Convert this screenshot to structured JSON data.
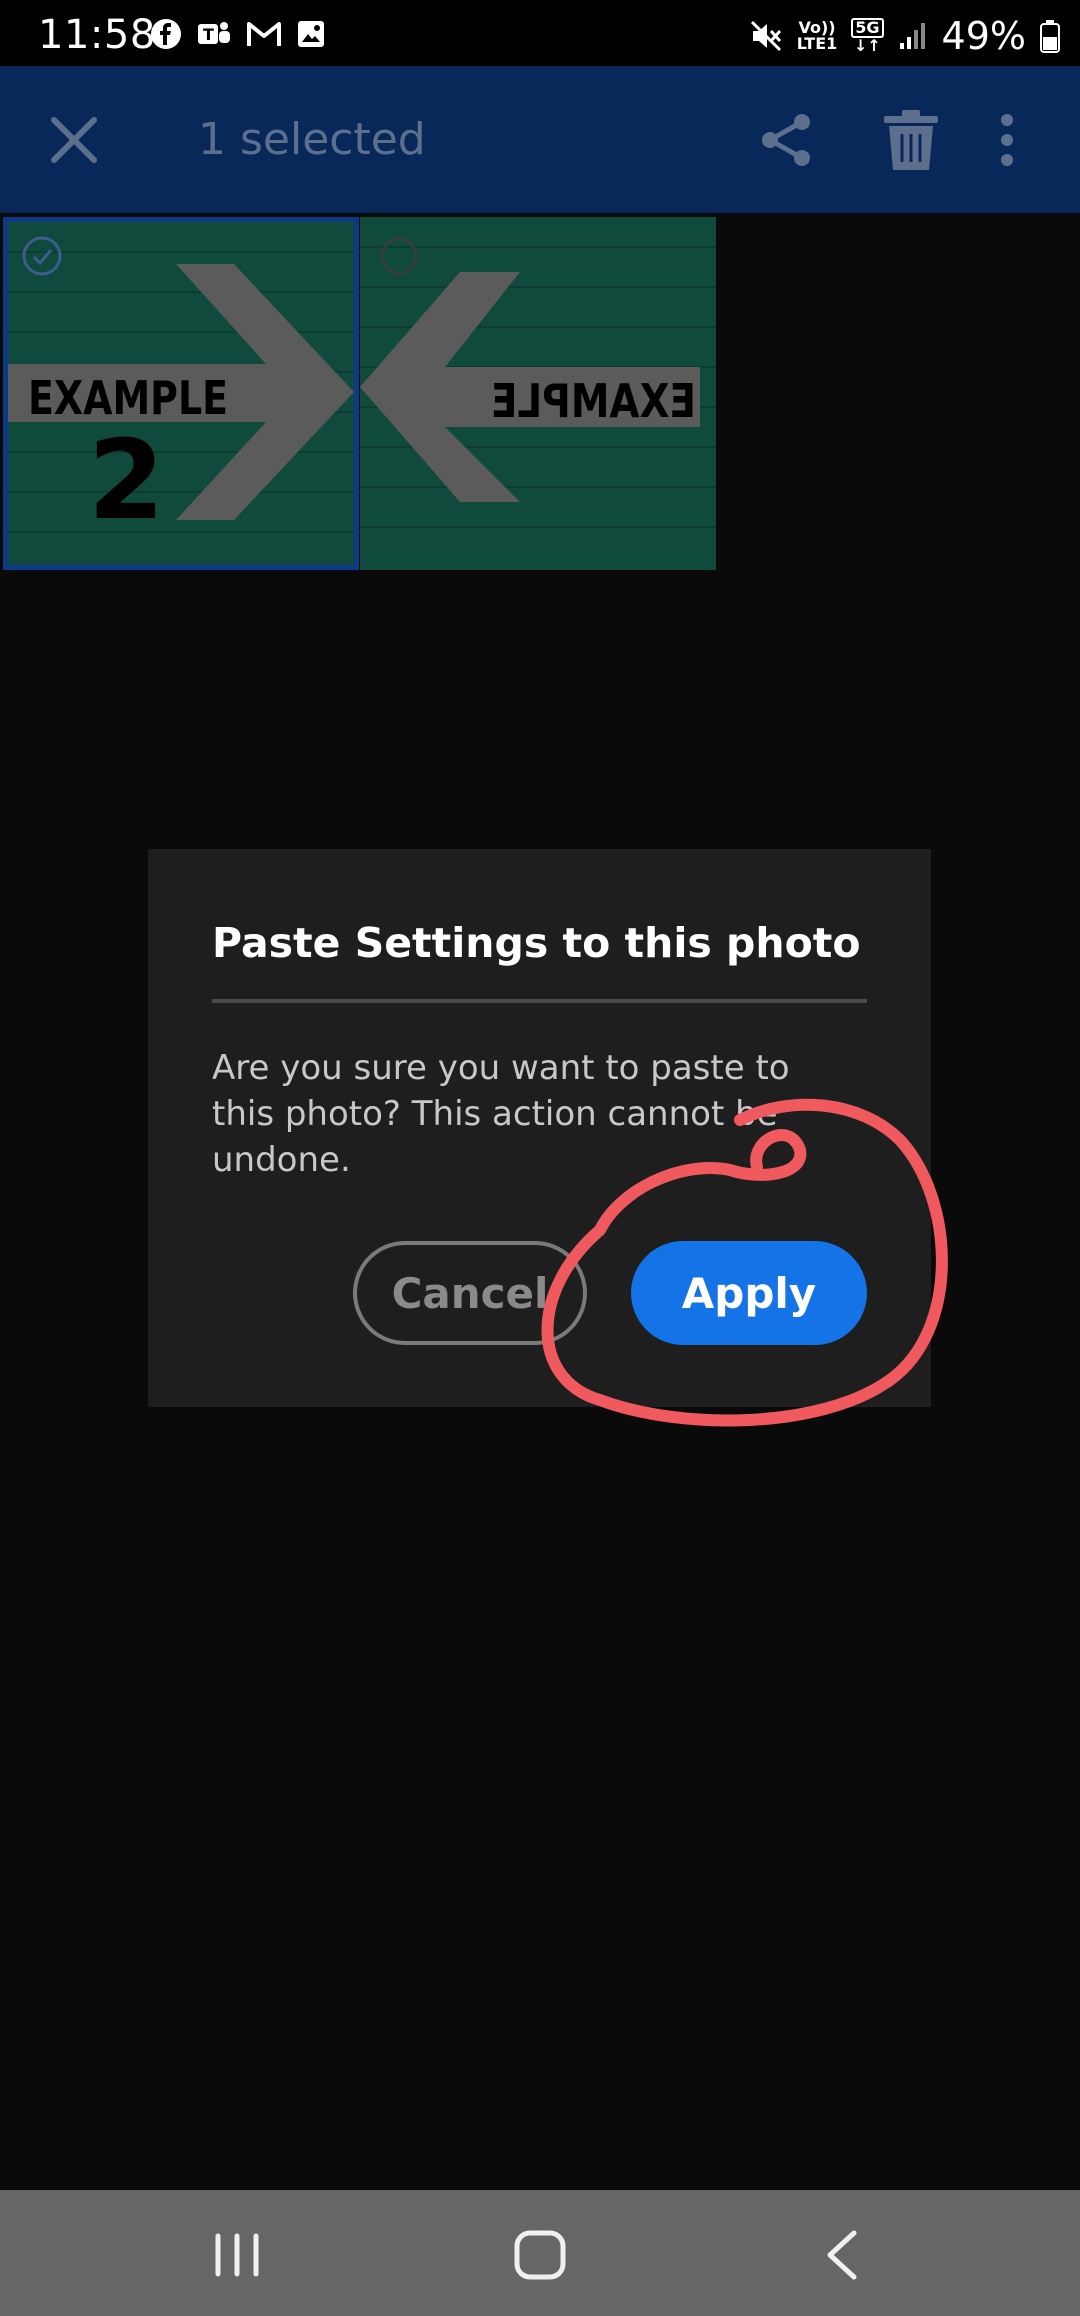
{
  "status_bar": {
    "time": "11:58",
    "left_icons": [
      "facebook-icon",
      "teams-icon",
      "gmail-icon",
      "gallery-icon"
    ],
    "network_top": "Vo))",
    "network_bottom": "LTE1",
    "network_5g": "5G",
    "battery_percent": "49%"
  },
  "app_bar": {
    "title": "1 selected",
    "background": "#08285a"
  },
  "photos": [
    {
      "label": "EXAMPLE",
      "number": "2",
      "selected": true
    },
    {
      "label": "EXAMPLE",
      "mirrored": true,
      "selected": false
    }
  ],
  "dialog": {
    "title": "Paste Settings to this photo",
    "body": "Are you sure you want to paste to this photo? This action cannot be undone.",
    "cancel_label": "Cancel",
    "apply_label": "Apply",
    "accent": "#1473e6"
  },
  "annotation": {
    "color": "#f05a5e"
  },
  "nav_bar": {
    "icons": [
      "recents-icon",
      "home-icon",
      "back-icon"
    ]
  }
}
